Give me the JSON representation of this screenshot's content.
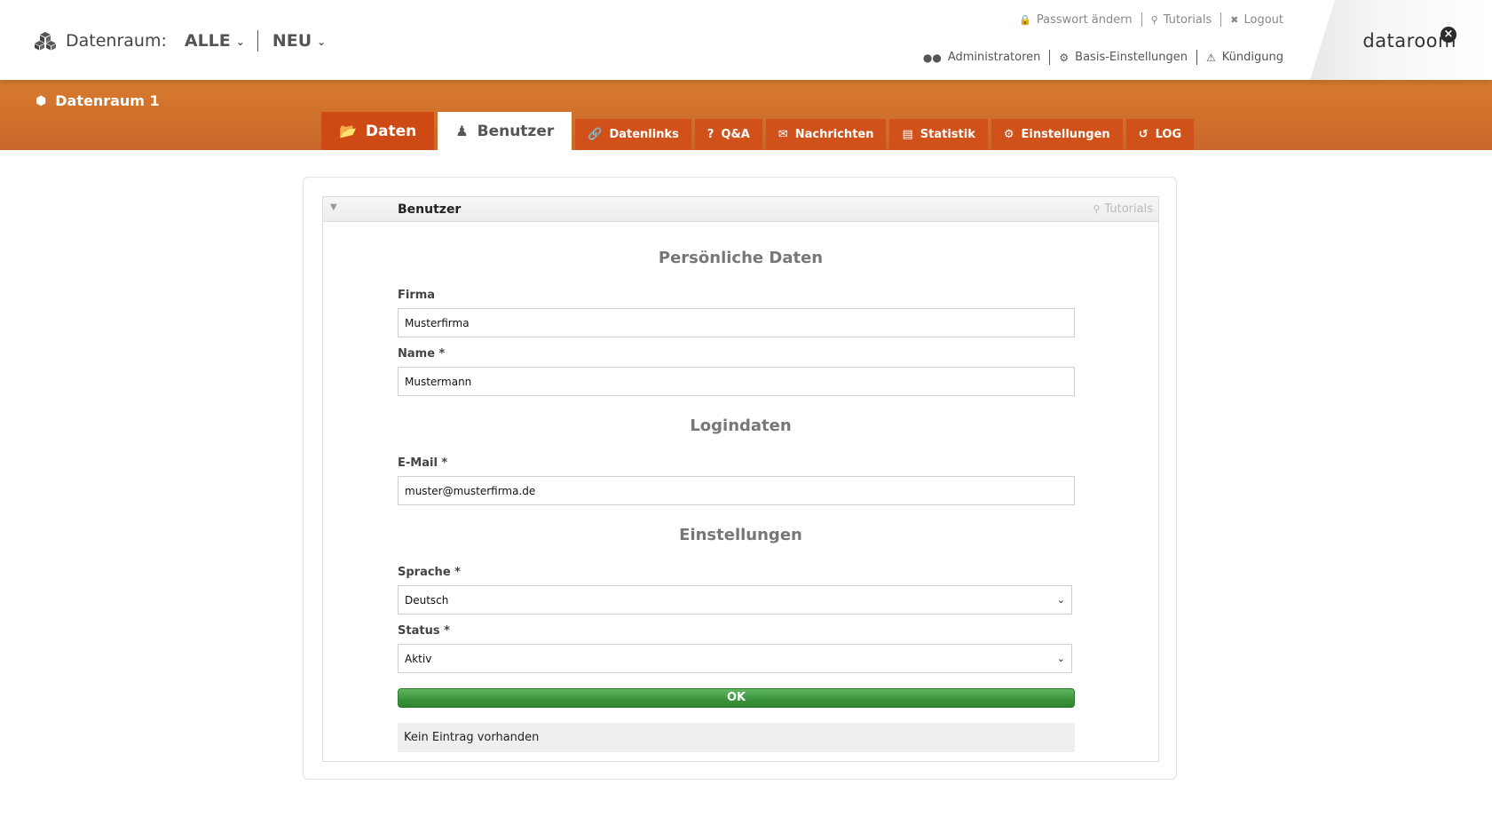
{
  "header": {
    "dataroom_label": "Datenraum:",
    "filter_all": "ALLE",
    "filter_new": "NEU",
    "top_links": {
      "change_password": "Passwort ändern",
      "tutorials": "Tutorials",
      "logout": "Logout"
    },
    "admin_links": {
      "administrators": "Administratoren",
      "basic_settings": "Basis-Einstellungen",
      "cancellation": "Kündigung"
    },
    "brand": "dataroom"
  },
  "room": {
    "title": "Datenraum 1"
  },
  "tabs": [
    {
      "label": "Daten",
      "icon": "folder-open-icon",
      "active": false
    },
    {
      "label": "Benutzer",
      "icon": "user-icon",
      "active": true
    },
    {
      "label": "Datenlinks",
      "icon": "link-icon"
    },
    {
      "label": "Q&A",
      "icon": "question-icon"
    },
    {
      "label": "Nachrichten",
      "icon": "envelope-icon"
    },
    {
      "label": "Statistik",
      "icon": "bar-chart-icon"
    },
    {
      "label": "Einstellungen",
      "icon": "gear-icon"
    },
    {
      "label": "LOG",
      "icon": "history-icon"
    }
  ],
  "panel": {
    "title": "Benutzer",
    "tutorials": "Tutorials"
  },
  "form": {
    "section_personal": "Persönliche Daten",
    "company_label": "Firma",
    "company_value": "Musterfirma",
    "name_label": "Name *",
    "name_value": "Mustermann",
    "section_login": "Logindaten",
    "email_label": "E-Mail *",
    "email_value": "muster@musterfirma.de",
    "section_settings": "Einstellungen",
    "language_label": "Sprache *",
    "language_value": "Deutsch",
    "status_label": "Status *",
    "status_value": "Aktiv",
    "ok_label": "OK",
    "empty_text": "Kein Eintrag vorhanden"
  },
  "colors": {
    "band": "#cf6d2b",
    "tab": "#d0521a",
    "ok_green": "#3a933a"
  }
}
